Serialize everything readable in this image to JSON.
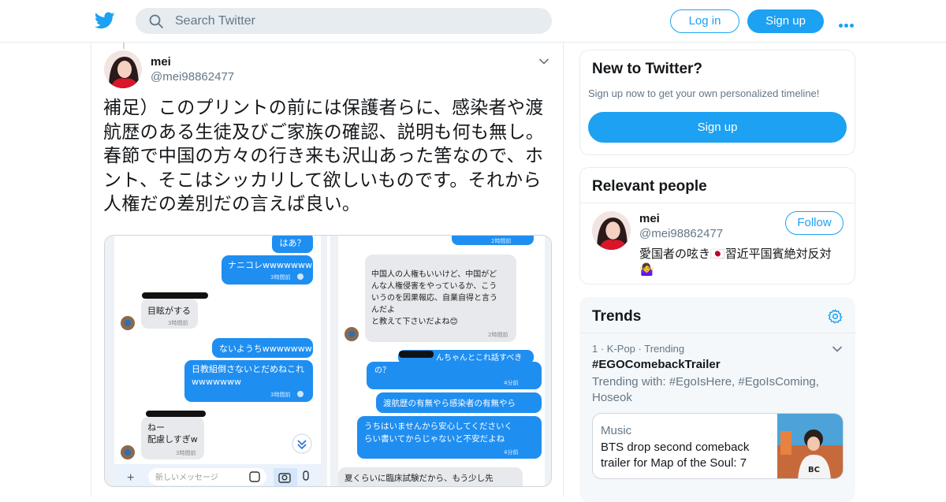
{
  "header": {
    "logo_icon": "twitter-bird-icon",
    "search_placeholder": "Search Twitter",
    "login_label": "Log in",
    "signup_label": "Sign up",
    "more_icon": "more-dots-icon",
    "accent": "#1da1f2"
  },
  "tweet": {
    "name": "mei",
    "handle": "@mei98862477",
    "text": "補足）このプリントの前には保護者らに、感染者や渡航歴のある生徒及びご家族の確認、説明も何も無し。春節で中国の方々の行き来も沢山あった筈なので、ホント、そこはシッカリして欲しいものです。それから人権だの差別だの言えば良い。",
    "caret_icon": "chevron-down-icon",
    "media": {
      "left": {
        "bubbles": [
          {
            "text": "はあ？",
            "time": ""
          },
          {
            "text": "ナニコレwwwwwww",
            "time": "3時間前"
          },
          {
            "text": "目眩がする",
            "time": "3時間前"
          },
          {
            "text": "ないようちwwwwwww",
            "time": ""
          },
          {
            "text": "日教組倒さないとだめねこれwwwwwww",
            "time": "3時間前"
          },
          {
            "text": "ねー",
            "line2": "配慮しすぎw",
            "time": "3時間前"
          }
        ],
        "input_placeholder": "新しいメッセージ"
      },
      "right": {
        "top_time": "2時間前",
        "received_lines": [
          "中国人の人権もいいけど、中国がど",
          "んな人権侵害をやっているか、こう",
          "いうのを因果報応、自業自得と言う",
          "んだよ",
          "と教えて下さいだよね😊"
        ],
        "received_time": "2時間前",
        "partial_sent": "んちゃんとこれ話すべき",
        "partial_sent_2": "の？",
        "sent_time_1": "4分前",
        "sent_2": "渡航歴の有無やら感染者の有無やら",
        "sent_3_line1": "うちはいませんから安心してくださいく",
        "sent_3_line2": "らい書いてからじゃないと不安だよね",
        "sent_time_3": "4分前",
        "received_2": "夏くらいに臨床試験だから、もう少し先"
      }
    }
  },
  "sidebar": {
    "new_to_twitter": {
      "title": "New to Twitter?",
      "subtitle": "Sign up now to get your own personalized timeline!",
      "button": "Sign up"
    },
    "relevant_people": {
      "title": "Relevant people",
      "name": "mei",
      "handle": "@mei98862477",
      "follow": "Follow",
      "bio": "愛国者の呟き🇯🇵習近平国賓絶対反対🤷‍♀️"
    },
    "trends": {
      "title": "Trends",
      "settings_icon": "gear-icon",
      "item": {
        "meta": "1 · K-Pop · Trending",
        "hashtag": "#EGOComebackTrailer",
        "trending_with": "Trending with: #EgoIsHere, #EgoIsComing, Hoseok",
        "card_category": "Music",
        "card_title": "BTS drop second comeback trailer for Map of the Soul: 7"
      }
    }
  }
}
